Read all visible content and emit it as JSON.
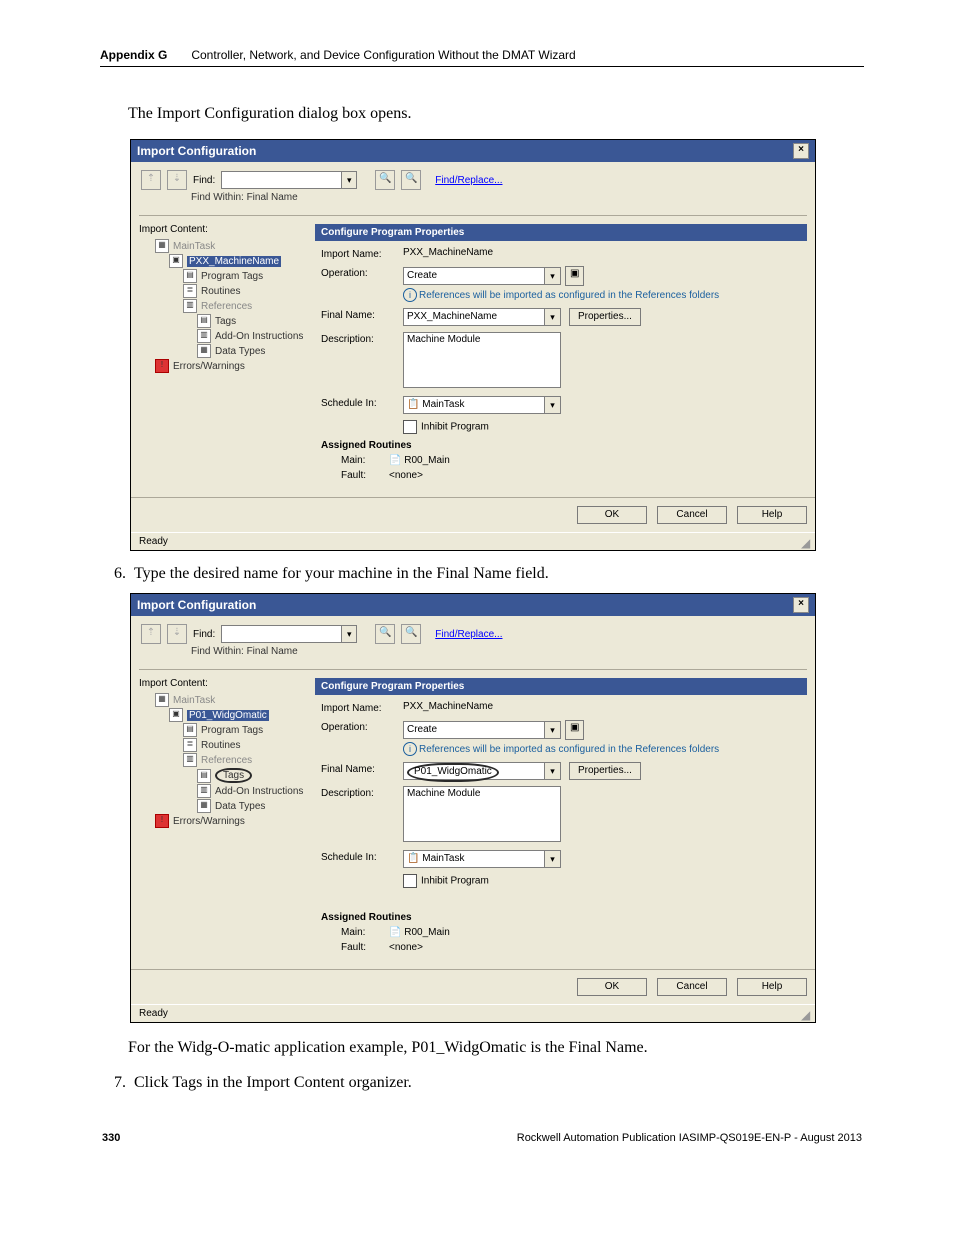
{
  "header": {
    "appendix": "Appendix G",
    "title": "Controller, Network, and Device Configuration Without the DMAT Wizard"
  },
  "intro": "The Import Configuration dialog box opens.",
  "dialog1": {
    "title": "Import Configuration",
    "find_label": "Find:",
    "find_within": "Find Within: Final Name",
    "find_replace": "Find/Replace...",
    "left": {
      "heading": "Import Content:",
      "items": [
        "MainTask",
        "PXX_MachineName",
        "Program Tags",
        "Routines",
        "References",
        "Tags",
        "Add-On Instructions",
        "Data Types",
        "Errors/Warnings"
      ]
    },
    "pane": {
      "header": "Configure Program Properties",
      "import_name_label": "Import Name:",
      "import_name": "PXX_MachineName",
      "operation_label": "Operation:",
      "operation": "Create",
      "note": "References will be imported as configured in the References folders",
      "final_name_label": "Final Name:",
      "final_name": "PXX_MachineName",
      "properties_btn": "Properties...",
      "description_label": "Description:",
      "description": "Machine Module",
      "schedule_label": "Schedule In:",
      "schedule": "MainTask",
      "inhibit": "Inhibit Program",
      "assigned": "Assigned Routines",
      "main_label": "Main:",
      "main": "R00_Main",
      "fault_label": "Fault:",
      "fault": "<none>"
    },
    "footer": {
      "ok": "OK",
      "cancel": "Cancel",
      "help": "Help"
    },
    "status": "Ready"
  },
  "step6": {
    "num": "6.",
    "text": "Type the desired name for your machine in the Final Name field."
  },
  "dialog2": {
    "title": "Import Configuration",
    "find_label": "Find:",
    "find_within": "Find Within: Final Name",
    "find_replace": "Find/Replace...",
    "left": {
      "heading": "Import Content:",
      "items": [
        "MainTask",
        "P01_WidgOmatic",
        "Program Tags",
        "Routines",
        "References",
        "Tags",
        "Add-On Instructions",
        "Data Types",
        "Errors/Warnings"
      ]
    },
    "pane": {
      "header": "Configure Program Properties",
      "import_name_label": "Import Name:",
      "import_name": "PXX_MachineName",
      "operation_label": "Operation:",
      "operation": "Create",
      "note": "References will be imported as configured in the References folders",
      "final_name_label": "Final Name:",
      "final_name": "P01_WidgOmatic",
      "properties_btn": "Properties...",
      "description_label": "Description:",
      "description": "Machine Module",
      "schedule_label": "Schedule In:",
      "schedule": "MainTask",
      "inhibit": "Inhibit Program",
      "assigned": "Assigned Routines",
      "main_label": "Main:",
      "main": "R00_Main",
      "fault_label": "Fault:",
      "fault": "<none>"
    },
    "footer": {
      "ok": "OK",
      "cancel": "Cancel",
      "help": "Help"
    },
    "status": "Ready"
  },
  "after2": "For the Widg-O-matic application example, P01_WidgOmatic is the Final Name.",
  "step7": {
    "num": "7.",
    "text": "Click Tags in the Import Content organizer."
  },
  "footer": {
    "page": "330",
    "pub": "Rockwell Automation Publication IASIMP-QS019E-EN-P - August 2013"
  }
}
